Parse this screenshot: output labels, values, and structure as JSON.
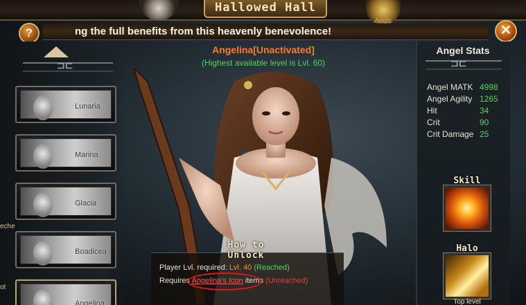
{
  "window": {
    "title": "Hallowed Hall",
    "emblem_text": "Aegis",
    "marquee": "ng the full benefits from this heavenly benevolence!",
    "help_label": "?",
    "close_label": "✕"
  },
  "angel_list": [
    {
      "name": "Lunaria"
    },
    {
      "name": "Marina"
    },
    {
      "name": "Glacia"
    },
    {
      "name": "Boadicea"
    },
    {
      "name": "Angelina"
    }
  ],
  "left_edge": {
    "upper": "eche",
    "lower": "ot"
  },
  "selected_angel": {
    "title": "Angelina[Unactivated]",
    "level_note": "(Highest available level is Lvl. 60)"
  },
  "unlock": {
    "heading": "How to Unlock",
    "level_label": "Player Lvl. required: ",
    "level_value": "Lvl. 40",
    "level_status": "(Reached)",
    "requires_label": "Requires ",
    "requires_item": "Angelina's Icon",
    "requires_suffix": " items ",
    "requires_status": "(Unreached)"
  },
  "stats": {
    "title": "Angel Stats",
    "rows": [
      {
        "label": "Angel MATK",
        "value": "4998"
      },
      {
        "label": "Angel Agility",
        "value": "1265"
      },
      {
        "label": "Hit",
        "value": "34"
      },
      {
        "label": "Crit",
        "value": "90"
      },
      {
        "label": "Crit Damage",
        "value": "25"
      }
    ]
  },
  "skill": {
    "label": "Skill"
  },
  "halo": {
    "label": "Halo",
    "caption": "Top level"
  },
  "colors": {
    "title_orange": "#ff7a2a",
    "ok_green": "#52d65a",
    "fail_red": "#e04030",
    "annotation_red": "#e01818"
  }
}
